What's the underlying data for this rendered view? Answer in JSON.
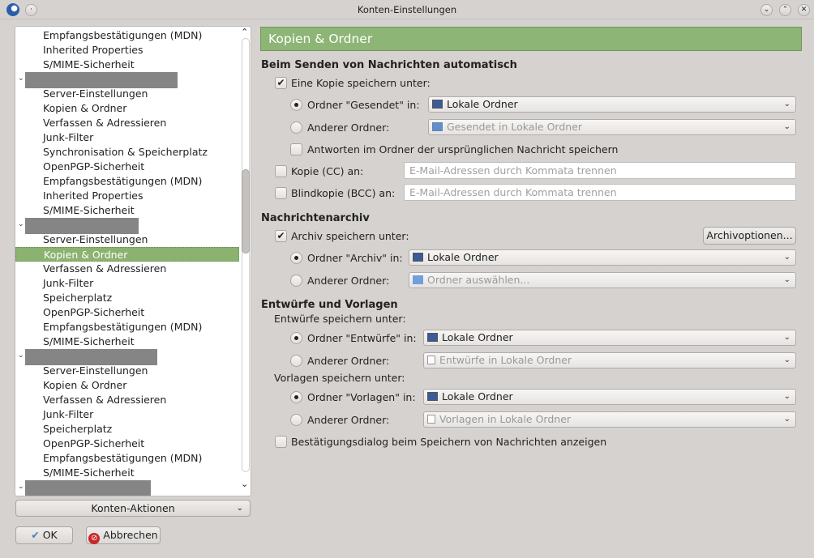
{
  "window": {
    "title": "Konten-Einstellungen"
  },
  "tree": {
    "items": [
      {
        "label": "Empfangsbestätigungen (MDN)"
      },
      {
        "label": "Inherited Properties"
      },
      {
        "label": "S/MIME-Sicherheit"
      },
      {
        "account": true
      },
      {
        "label": "Server-Einstellungen"
      },
      {
        "label": "Kopien & Ordner"
      },
      {
        "label": "Verfassen & Adressieren"
      },
      {
        "label": "Junk-Filter"
      },
      {
        "label": "Synchronisation & Speicherplatz"
      },
      {
        "label": "OpenPGP-Sicherheit"
      },
      {
        "label": "Empfangsbestätigungen (MDN)"
      },
      {
        "label": "Inherited Properties"
      },
      {
        "label": "S/MIME-Sicherheit"
      },
      {
        "account": true
      },
      {
        "label": "Server-Einstellungen"
      },
      {
        "label": "Kopien & Ordner",
        "selected": true
      },
      {
        "label": "Verfassen & Adressieren"
      },
      {
        "label": "Junk-Filter"
      },
      {
        "label": "Speicherplatz"
      },
      {
        "label": "OpenPGP-Sicherheit"
      },
      {
        "label": "Empfangsbestätigungen (MDN)"
      },
      {
        "label": "S/MIME-Sicherheit"
      },
      {
        "account": true
      },
      {
        "label": "Server-Einstellungen"
      },
      {
        "label": "Kopien & Ordner"
      },
      {
        "label": "Verfassen & Adressieren"
      },
      {
        "label": "Junk-Filter"
      },
      {
        "label": "Speicherplatz"
      },
      {
        "label": "OpenPGP-Sicherheit"
      },
      {
        "label": "Empfangsbestätigungen (MDN)"
      },
      {
        "label": "S/MIME-Sicherheit"
      },
      {
        "account": true
      }
    ]
  },
  "actions": {
    "konten": "Konten-Aktionen",
    "ok": "OK",
    "cancel": "Abbrechen"
  },
  "panel": {
    "title": "Kopien & Ordner",
    "send": {
      "heading": "Beim Senden von Nachrichten automatisch",
      "copy": "Eine Kopie speichern unter:",
      "sent_radio": "Ordner \"Gesendet\" in:",
      "sent_value": "Lokale Ordner",
      "other": "Anderer Ordner:",
      "other_value": "Gesendet in Lokale Ordner",
      "reply": "Antworten im Ordner der ursprünglichen Nachricht speichern",
      "cc": "Kopie (CC) an:",
      "bcc": "Blindkopie (BCC) an:",
      "placeholder": "E-Mail-Adressen durch Kommata trennen"
    },
    "archive": {
      "heading": "Nachrichtenarchiv",
      "save": "Archiv speichern unter:",
      "options": "Archivoptionen...",
      "radio": "Ordner \"Archiv\" in:",
      "value": "Lokale Ordner",
      "other": "Anderer Ordner:",
      "other_value": "Ordner auswählen..."
    },
    "drafts": {
      "heading": "Entwürfe und Vorlagen",
      "drafts_label": "Entwürfe speichern unter:",
      "drafts_radio": "Ordner \"Entwürfe\" in:",
      "drafts_value": "Lokale Ordner",
      "other": "Anderer Ordner:",
      "drafts_other_value": "Entwürfe in Lokale Ordner",
      "templates_label": "Vorlagen speichern unter:",
      "templates_radio": "Ordner \"Vorlagen\" in:",
      "templates_value": "Lokale Ordner",
      "templates_other_value": "Vorlagen in Lokale Ordner",
      "confirm": "Bestätigungsdialog beim Speichern von Nachrichten anzeigen"
    }
  }
}
